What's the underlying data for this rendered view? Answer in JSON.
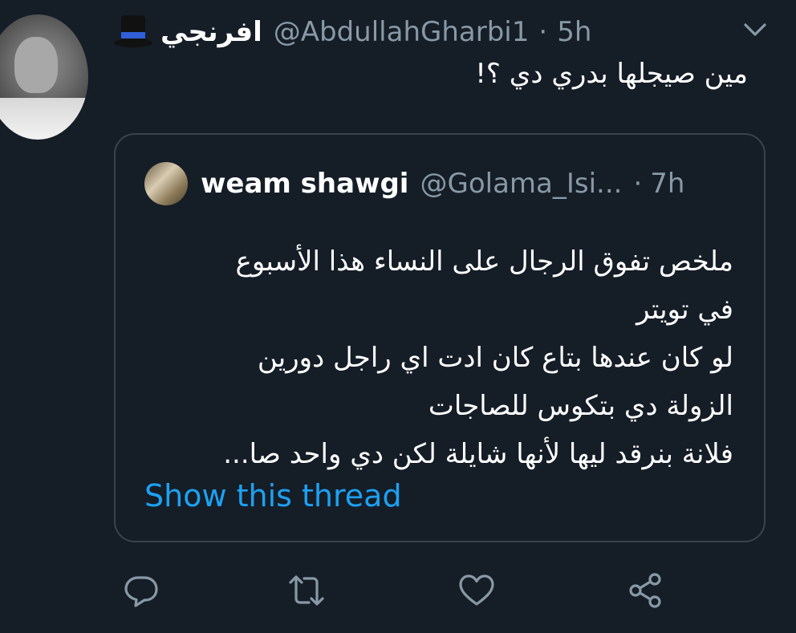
{
  "tweet": {
    "display_name": "افرنجي",
    "handle": "@AbdullahGharbi1",
    "separator": "·",
    "time": "5h",
    "text": "مين صيجلها بدري دي ؟!"
  },
  "quoted_tweet": {
    "display_name": "weam shawgi",
    "handle": "@Golama_Isi...",
    "separator": "·",
    "time": "7h",
    "lines": [
      "ملخص تفوق الرجال على النساء هذا الأسبوع",
      "في تويتر",
      "لو كان عندها بتاع كان ادت اي راجل دورين",
      "الزولة دي بتكوس للصاجات",
      "فلانة بنرقد ليها لأنها شايلة لكن دي واحد صا..."
    ],
    "show_thread_label": "Show this thread"
  },
  "icons": {
    "hat": "top-hat-emoji-icon",
    "menu": "chevron-down-icon",
    "reply": "reply-icon",
    "retweet": "retweet-icon",
    "like": "heart-icon",
    "share": "share-icon"
  },
  "colors": {
    "background": "#151d27",
    "primary_text": "#ffffff",
    "secondary_text": "#8899a6",
    "link": "#1da1f2",
    "border": "#38444d"
  }
}
